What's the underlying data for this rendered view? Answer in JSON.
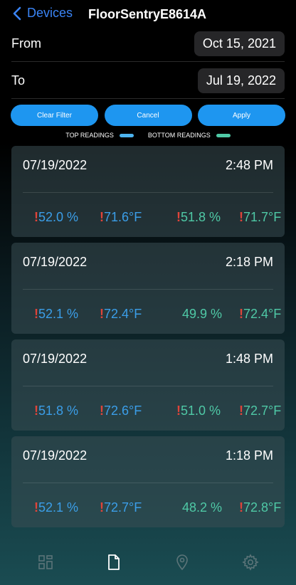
{
  "nav": {
    "back_label": "Devices",
    "title": "FloorSentryE8614A"
  },
  "filter": {
    "from_label": "From",
    "from_value": "Oct 15, 2021",
    "to_label": "To",
    "to_value": "Jul 19, 2022",
    "clear_label": "Clear Filter",
    "cancel_label": "Cancel",
    "apply_label": "Apply"
  },
  "legend": {
    "top_label": "TOP READINGS",
    "top_color": "#4db3ee",
    "bottom_label": "BOTTOM READINGS",
    "bottom_color": "#4fc9a6"
  },
  "readings": [
    {
      "date": "07/19/2022",
      "time": "2:48 PM",
      "values": [
        {
          "alert": true,
          "text": "52.0 %"
        },
        {
          "alert": true,
          "text": "71.6°F"
        },
        {
          "alert": true,
          "text": "51.8 %"
        },
        {
          "alert": true,
          "text": "71.7°F"
        }
      ]
    },
    {
      "date": "07/19/2022",
      "time": "2:18 PM",
      "values": [
        {
          "alert": true,
          "text": "52.1 %"
        },
        {
          "alert": true,
          "text": "72.4°F"
        },
        {
          "alert": false,
          "text": "49.9 %"
        },
        {
          "alert": true,
          "text": "72.4°F"
        }
      ]
    },
    {
      "date": "07/19/2022",
      "time": "1:48 PM",
      "values": [
        {
          "alert": true,
          "text": "51.8 %"
        },
        {
          "alert": true,
          "text": "72.6°F"
        },
        {
          "alert": true,
          "text": "51.0 %"
        },
        {
          "alert": true,
          "text": "72.7°F"
        }
      ]
    },
    {
      "date": "07/19/2022",
      "time": "1:18 PM",
      "values": [
        {
          "alert": true,
          "text": "52.1 %"
        },
        {
          "alert": true,
          "text": "72.7°F"
        },
        {
          "alert": false,
          "text": "48.2 %"
        },
        {
          "alert": true,
          "text": "72.8°F"
        }
      ]
    }
  ],
  "alert_mark": "!",
  "tabs": [
    {
      "icon": "dashboard-grid-icon",
      "active": false
    },
    {
      "icon": "document-icon",
      "active": true
    },
    {
      "icon": "location-pin-icon",
      "active": false
    },
    {
      "icon": "gear-icon",
      "active": false
    }
  ]
}
